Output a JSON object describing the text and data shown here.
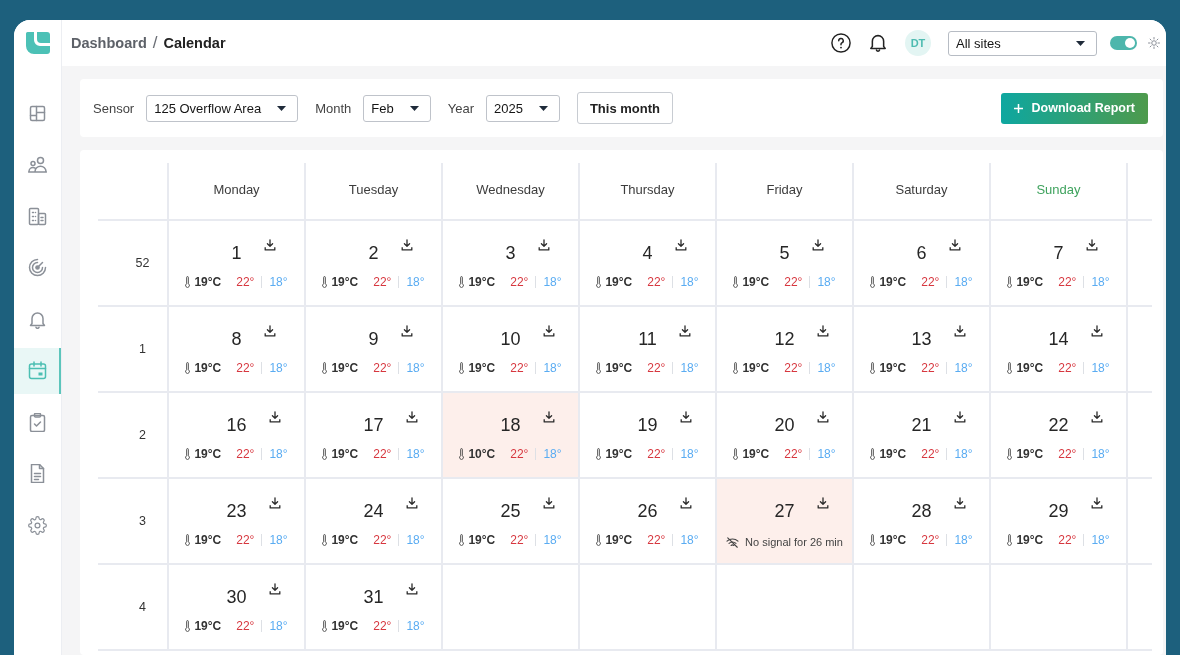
{
  "header": {
    "breadcrumb": [
      "Dashboard",
      "Calendar"
    ],
    "separator": "/",
    "avatar": "DT",
    "site_select": "All sites",
    "theme_toggle": {
      "on": true
    }
  },
  "sidebar": {
    "items": [
      {
        "kind": "dashboard",
        "selected": false
      },
      {
        "kind": "people",
        "selected": false
      },
      {
        "kind": "buildings",
        "selected": false
      },
      {
        "kind": "radar",
        "selected": false
      },
      {
        "kind": "alerts",
        "selected": false
      },
      {
        "kind": "calendar",
        "selected": true
      },
      {
        "kind": "tasks",
        "selected": false
      },
      {
        "kind": "reports",
        "selected": false
      },
      {
        "kind": "settings",
        "selected": false
      }
    ]
  },
  "filters": {
    "fields": [
      {
        "label": "Sensor",
        "value": "125 Overflow Area"
      },
      {
        "label": "Month",
        "value": "Feb"
      },
      {
        "label": "Year",
        "value": "2025"
      }
    ],
    "this_month_button": "This month",
    "download_button": "Download Report"
  },
  "calendar": {
    "columns": [
      {
        "label": "Monday",
        "highlighted": false
      },
      {
        "label": "Tuesday",
        "highlighted": false
      },
      {
        "label": "Wednesday",
        "highlighted": false
      },
      {
        "label": "Thursday",
        "highlighted": false
      },
      {
        "label": "Friday",
        "highlighted": false
      },
      {
        "label": "Saturday",
        "highlighted": false
      },
      {
        "label": "Sunday",
        "highlighted": true
      }
    ],
    "weeks": [
      {
        "week": "52",
        "days": [
          {
            "kind": "reading",
            "day": "1",
            "temperature": "19°C",
            "high": "22°",
            "low": "18°",
            "alert": false
          },
          {
            "kind": "reading",
            "day": "2",
            "temperature": "19°C",
            "high": "22°",
            "low": "18°",
            "alert": false
          },
          {
            "kind": "reading",
            "day": "3",
            "temperature": "19°C",
            "high": "22°",
            "low": "18°",
            "alert": false
          },
          {
            "kind": "reading",
            "day": "4",
            "temperature": "19°C",
            "high": "22°",
            "low": "18°",
            "alert": false
          },
          {
            "kind": "reading",
            "day": "5",
            "temperature": "19°C",
            "high": "22°",
            "low": "18°",
            "alert": false
          },
          {
            "kind": "reading",
            "day": "6",
            "temperature": "19°C",
            "high": "22°",
            "low": "18°",
            "alert": false
          },
          {
            "kind": "reading",
            "day": "7",
            "temperature": "19°C",
            "high": "22°",
            "low": "18°",
            "alert": false
          }
        ]
      },
      {
        "week": "1",
        "days": [
          {
            "kind": "reading",
            "day": "8",
            "temperature": "19°C",
            "high": "22°",
            "low": "18°",
            "alert": false
          },
          {
            "kind": "reading",
            "day": "9",
            "temperature": "19°C",
            "high": "22°",
            "low": "18°",
            "alert": false
          },
          {
            "kind": "reading",
            "day": "10",
            "temperature": "19°C",
            "high": "22°",
            "low": "18°",
            "alert": false
          },
          {
            "kind": "reading",
            "day": "11",
            "temperature": "19°C",
            "high": "22°",
            "low": "18°",
            "alert": false
          },
          {
            "kind": "reading",
            "day": "12",
            "temperature": "19°C",
            "high": "22°",
            "low": "18°",
            "alert": false
          },
          {
            "kind": "reading",
            "day": "13",
            "temperature": "19°C",
            "high": "22°",
            "low": "18°",
            "alert": false
          },
          {
            "kind": "reading",
            "day": "14",
            "temperature": "19°C",
            "high": "22°",
            "low": "18°",
            "alert": false
          }
        ]
      },
      {
        "week": "2",
        "days": [
          {
            "kind": "reading",
            "day": "16",
            "temperature": "19°C",
            "high": "22°",
            "low": "18°",
            "alert": false
          },
          {
            "kind": "reading",
            "day": "17",
            "temperature": "19°C",
            "high": "22°",
            "low": "18°",
            "alert": false
          },
          {
            "kind": "reading",
            "day": "18",
            "temperature": "10°C",
            "high": "22°",
            "low": "18°",
            "alert": true
          },
          {
            "kind": "reading",
            "day": "19",
            "temperature": "19°C",
            "high": "22°",
            "low": "18°",
            "alert": false
          },
          {
            "kind": "reading",
            "day": "20",
            "temperature": "19°C",
            "high": "22°",
            "low": "18°",
            "alert": false
          },
          {
            "kind": "reading",
            "day": "21",
            "temperature": "19°C",
            "high": "22°",
            "low": "18°",
            "alert": false
          },
          {
            "kind": "reading",
            "day": "22",
            "temperature": "19°C",
            "high": "22°",
            "low": "18°",
            "alert": false
          }
        ]
      },
      {
        "week": "3",
        "days": [
          {
            "kind": "reading",
            "day": "23",
            "temperature": "19°C",
            "high": "22°",
            "low": "18°",
            "alert": false
          },
          {
            "kind": "reading",
            "day": "24",
            "temperature": "19°C",
            "high": "22°",
            "low": "18°",
            "alert": false
          },
          {
            "kind": "reading",
            "day": "25",
            "temperature": "19°C",
            "high": "22°",
            "low": "18°",
            "alert": false
          },
          {
            "kind": "reading",
            "day": "26",
            "temperature": "19°C",
            "high": "22°",
            "low": "18°",
            "alert": false
          },
          {
            "kind": "no_signal",
            "day": "27",
            "message": "No signal for 26 min",
            "alert": true
          },
          {
            "kind": "reading",
            "day": "28",
            "temperature": "19°C",
            "high": "22°",
            "low": "18°",
            "alert": false
          },
          {
            "kind": "reading",
            "day": "29",
            "temperature": "19°C",
            "high": "22°",
            "low": "18°",
            "alert": false
          }
        ]
      },
      {
        "week": "4",
        "days": [
          {
            "kind": "reading",
            "day": "30",
            "temperature": "19°C",
            "high": "22°",
            "low": "18°",
            "alert": false
          },
          {
            "kind": "reading",
            "day": "31",
            "temperature": "19°C",
            "high": "22°",
            "low": "18°",
            "alert": false
          }
        ]
      }
    ]
  }
}
